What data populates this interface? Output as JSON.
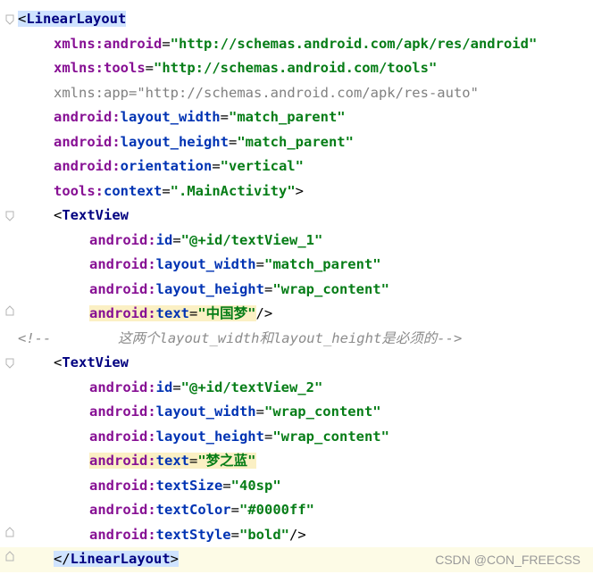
{
  "lines": [
    {
      "parts": [
        {
          "cls": "punct hl-tag",
          "text": "<"
        },
        {
          "cls": "tag hl-tag",
          "text": "LinearLayout"
        }
      ],
      "indent": 0,
      "gutter": "fold-open"
    },
    {
      "parts": [
        {
          "cls": "ns",
          "text": "xmlns:"
        },
        {
          "cls": "ns",
          "text": "android"
        },
        {
          "cls": "punct",
          "text": "="
        },
        {
          "cls": "str",
          "text": "\"http://schemas.android.com/apk/res/android\""
        }
      ],
      "indent": 1
    },
    {
      "parts": [
        {
          "cls": "ns",
          "text": "xmlns:"
        },
        {
          "cls": "ns",
          "text": "tools"
        },
        {
          "cls": "punct",
          "text": "="
        },
        {
          "cls": "str",
          "text": "\"http://schemas.android.com/tools\""
        }
      ],
      "indent": 1
    },
    {
      "parts": [
        {
          "cls": "dim-attr",
          "text": "xmlns:app"
        },
        {
          "cls": "dim-attr",
          "text": "="
        },
        {
          "cls": "dim-str",
          "text": "\"http://schemas.android.com/apk/res-auto\""
        }
      ],
      "indent": 1
    },
    {
      "parts": [
        {
          "cls": "ns",
          "text": "android:"
        },
        {
          "cls": "attr",
          "text": "layout_width"
        },
        {
          "cls": "punct",
          "text": "="
        },
        {
          "cls": "str",
          "text": "\"match_parent\""
        }
      ],
      "indent": 1
    },
    {
      "parts": [
        {
          "cls": "ns",
          "text": "android:"
        },
        {
          "cls": "attr",
          "text": "layout_height"
        },
        {
          "cls": "punct",
          "text": "="
        },
        {
          "cls": "str",
          "text": "\"match_parent\""
        }
      ],
      "indent": 1
    },
    {
      "parts": [
        {
          "cls": "ns",
          "text": "android:"
        },
        {
          "cls": "attr",
          "text": "orientation"
        },
        {
          "cls": "punct",
          "text": "="
        },
        {
          "cls": "str",
          "text": "\"vertical\""
        }
      ],
      "indent": 1
    },
    {
      "parts": [
        {
          "cls": "ns",
          "text": "tools:"
        },
        {
          "cls": "attr",
          "text": "context"
        },
        {
          "cls": "punct",
          "text": "="
        },
        {
          "cls": "str",
          "text": "\".MainActivity\""
        },
        {
          "cls": "punct",
          "text": ">"
        }
      ],
      "indent": 1
    },
    {
      "parts": [
        {
          "cls": "punct",
          "text": "<"
        },
        {
          "cls": "tag",
          "text": "TextView"
        }
      ],
      "indent": 1,
      "gutter": "fold-open"
    },
    {
      "parts": [
        {
          "cls": "ns",
          "text": "android:"
        },
        {
          "cls": "attr",
          "text": "id"
        },
        {
          "cls": "punct",
          "text": "="
        },
        {
          "cls": "str",
          "text": "\"@+id/textView_1\""
        }
      ],
      "indent": 2
    },
    {
      "parts": [
        {
          "cls": "ns",
          "text": "android:"
        },
        {
          "cls": "attr",
          "text": "layout_width"
        },
        {
          "cls": "punct",
          "text": "="
        },
        {
          "cls": "str",
          "text": "\"match_parent\""
        }
      ],
      "indent": 2
    },
    {
      "parts": [
        {
          "cls": "ns",
          "text": "android:"
        },
        {
          "cls": "attr",
          "text": "layout_height"
        },
        {
          "cls": "punct",
          "text": "="
        },
        {
          "cls": "str",
          "text": "\"wrap_content\""
        }
      ],
      "indent": 2
    },
    {
      "parts": [
        {
          "cls": "ns hl-attr",
          "text": "android:"
        },
        {
          "cls": "attr hl-attr",
          "text": "text"
        },
        {
          "cls": "punct hl-attr",
          "text": "="
        },
        {
          "cls": "str hl-attr",
          "text": "\"中国梦\""
        },
        {
          "cls": "punct",
          "text": "/>"
        }
      ],
      "indent": 2,
      "gutter": "fold-close"
    },
    {
      "parts": [
        {
          "cls": "comment",
          "text": "<!--        这两个layout_width和layout_height是必须的-->"
        }
      ],
      "indent": 0
    },
    {
      "parts": [
        {
          "cls": "punct",
          "text": "<"
        },
        {
          "cls": "tag",
          "text": "TextView"
        }
      ],
      "indent": 1,
      "gutter": "fold-open"
    },
    {
      "parts": [
        {
          "cls": "ns",
          "text": "android:"
        },
        {
          "cls": "attr",
          "text": "id"
        },
        {
          "cls": "punct",
          "text": "="
        },
        {
          "cls": "str",
          "text": "\"@+id/textView_2\""
        }
      ],
      "indent": 2
    },
    {
      "parts": [
        {
          "cls": "ns",
          "text": "android:"
        },
        {
          "cls": "attr",
          "text": "layout_width"
        },
        {
          "cls": "punct",
          "text": "="
        },
        {
          "cls": "str",
          "text": "\"wrap_content\""
        }
      ],
      "indent": 2
    },
    {
      "parts": [
        {
          "cls": "ns",
          "text": "android:"
        },
        {
          "cls": "attr",
          "text": "layout_height"
        },
        {
          "cls": "punct",
          "text": "="
        },
        {
          "cls": "str",
          "text": "\"wrap_content\""
        }
      ],
      "indent": 2
    },
    {
      "parts": [
        {
          "cls": "ns hl-attr",
          "text": "android:"
        },
        {
          "cls": "attr hl-attr",
          "text": "text"
        },
        {
          "cls": "punct hl-attr",
          "text": "="
        },
        {
          "cls": "str hl-attr",
          "text": "\"梦之蓝\""
        }
      ],
      "indent": 2
    },
    {
      "parts": [
        {
          "cls": "ns",
          "text": "android:"
        },
        {
          "cls": "attr",
          "text": "textSize"
        },
        {
          "cls": "punct",
          "text": "="
        },
        {
          "cls": "str",
          "text": "\"40sp\""
        }
      ],
      "indent": 2
    },
    {
      "parts": [
        {
          "cls": "ns",
          "text": "android:"
        },
        {
          "cls": "attr",
          "text": "textColor"
        },
        {
          "cls": "punct",
          "text": "="
        },
        {
          "cls": "str",
          "text": "\"#0000ff\""
        }
      ],
      "indent": 2
    },
    {
      "parts": [
        {
          "cls": "ns",
          "text": "android:"
        },
        {
          "cls": "attr",
          "text": "textStyle"
        },
        {
          "cls": "punct",
          "text": "="
        },
        {
          "cls": "str",
          "text": "\"bold\""
        },
        {
          "cls": "punct",
          "text": "/>"
        }
      ],
      "indent": 2,
      "gutter": "fold-close"
    },
    {
      "parts": [
        {
          "cls": "punct hl-tag",
          "text": "</"
        },
        {
          "cls": "tag hl-tag",
          "text": "LinearLayout"
        },
        {
          "cls": "punct hl-tag",
          "text": ">"
        }
      ],
      "indent": 1,
      "gutter": "fold-close",
      "current": true
    }
  ],
  "watermark": "CSDN @CON_FREECSS",
  "colors": {
    "background": "#ffffff",
    "tag": "#000080",
    "namespace": "#871094",
    "attribute": "#0033b3",
    "string": "#067d17",
    "comment": "#8c8c8c",
    "tag_highlight": "#cfe3ff",
    "attr_highlight": "#fbf0c4"
  },
  "icons": [
    "fold-open-icon",
    "fold-close-icon",
    "warning-icon"
  ]
}
